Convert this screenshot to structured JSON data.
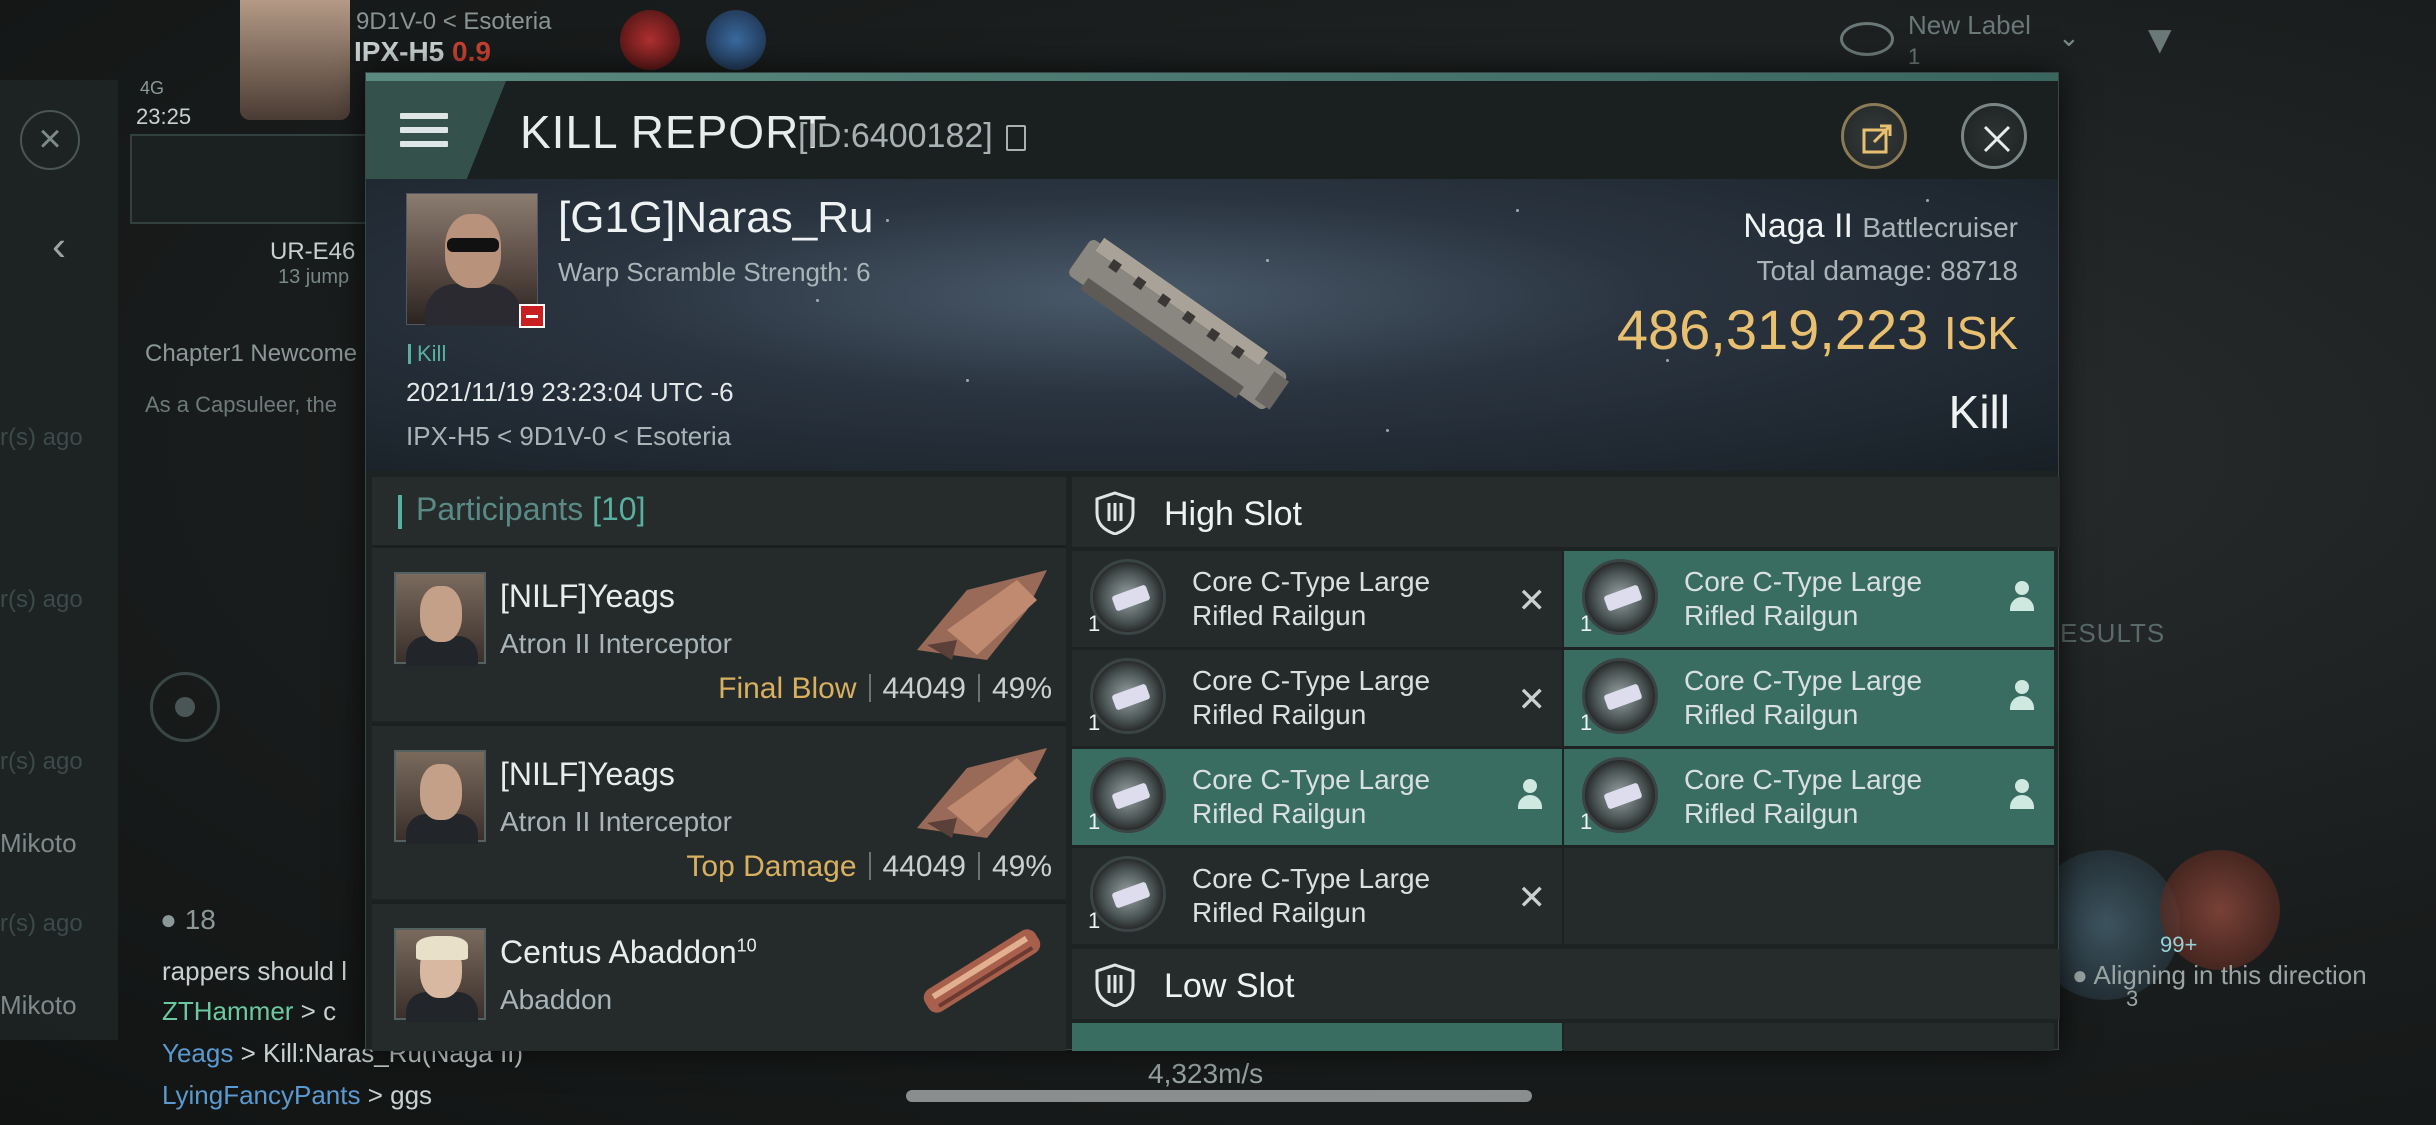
{
  "background": {
    "system_chain": "9D1V-0 < Esoteria",
    "current_system": "IPX-H5",
    "security": "0.9",
    "network": "4G",
    "clock": "23:25",
    "route_dest": "UR-E46",
    "route_jumps": "13 jump",
    "chat_channel": "Chapter1 Newcome",
    "chat_preview": "As a Capsuleer, the",
    "member_count": "18",
    "chat_lines": [
      {
        "text": "rappers should l"
      },
      {
        "name": "ZTHammer",
        "rest": " > c"
      },
      {
        "name": "Yeags",
        "rest": " > Kill:Naras_Ru(Naga II)"
      },
      {
        "name": "LyingFancyPants",
        "rest": " > ggs"
      }
    ],
    "side_names": [
      "Mikoto",
      "Mikoto"
    ],
    "ago_lines": [
      "r(s) ago",
      "r(s) ago",
      "r(s) ago",
      "r(s) ago"
    ],
    "new_label": "New Label",
    "new_label_count": "1",
    "results": "ESULTS",
    "aligning": "Aligning in this direction",
    "speed": "4,323m/s",
    "badge_99": "99+",
    "count_3": "3"
  },
  "header": {
    "title": "KILL REPORT",
    "id": "[ID:6400182]"
  },
  "victim": {
    "name": "[G1G]Naras_Ru",
    "warp": "Warp Scramble Strength: 6",
    "tag": "Kill",
    "datetime": "2021/11/19 23:23:04 UTC -6",
    "location": "IPX-H5 < 9D1V-0 < Esoteria",
    "ship": "Naga II",
    "ship_class": "Battlecruiser",
    "total_damage_label": "Total damage:",
    "total_damage": "88718",
    "isk_value": "486,319,223",
    "isk_unit": "ISK",
    "result": "Kill"
  },
  "participants": {
    "title": "Participants",
    "count": "[10]",
    "rows": [
      {
        "name": "[NILF]Yeags",
        "ship": "Atron II Interceptor",
        "label": "Final Blow",
        "damage": "44049",
        "pct": "49%"
      },
      {
        "name": "[NILF]Yeags",
        "ship": "Atron II Interceptor",
        "label": "Top Damage",
        "damage": "44049",
        "pct": "49%"
      },
      {
        "name": "Centus Abaddon",
        "sup": "10",
        "ship": "Abaddon"
      }
    ]
  },
  "slots": {
    "high_label": "High Slot",
    "low_label": "Low Slot",
    "module_line1": "Core C-Type Large",
    "module_line2": "Rifled Railgun",
    "qty": "1"
  }
}
